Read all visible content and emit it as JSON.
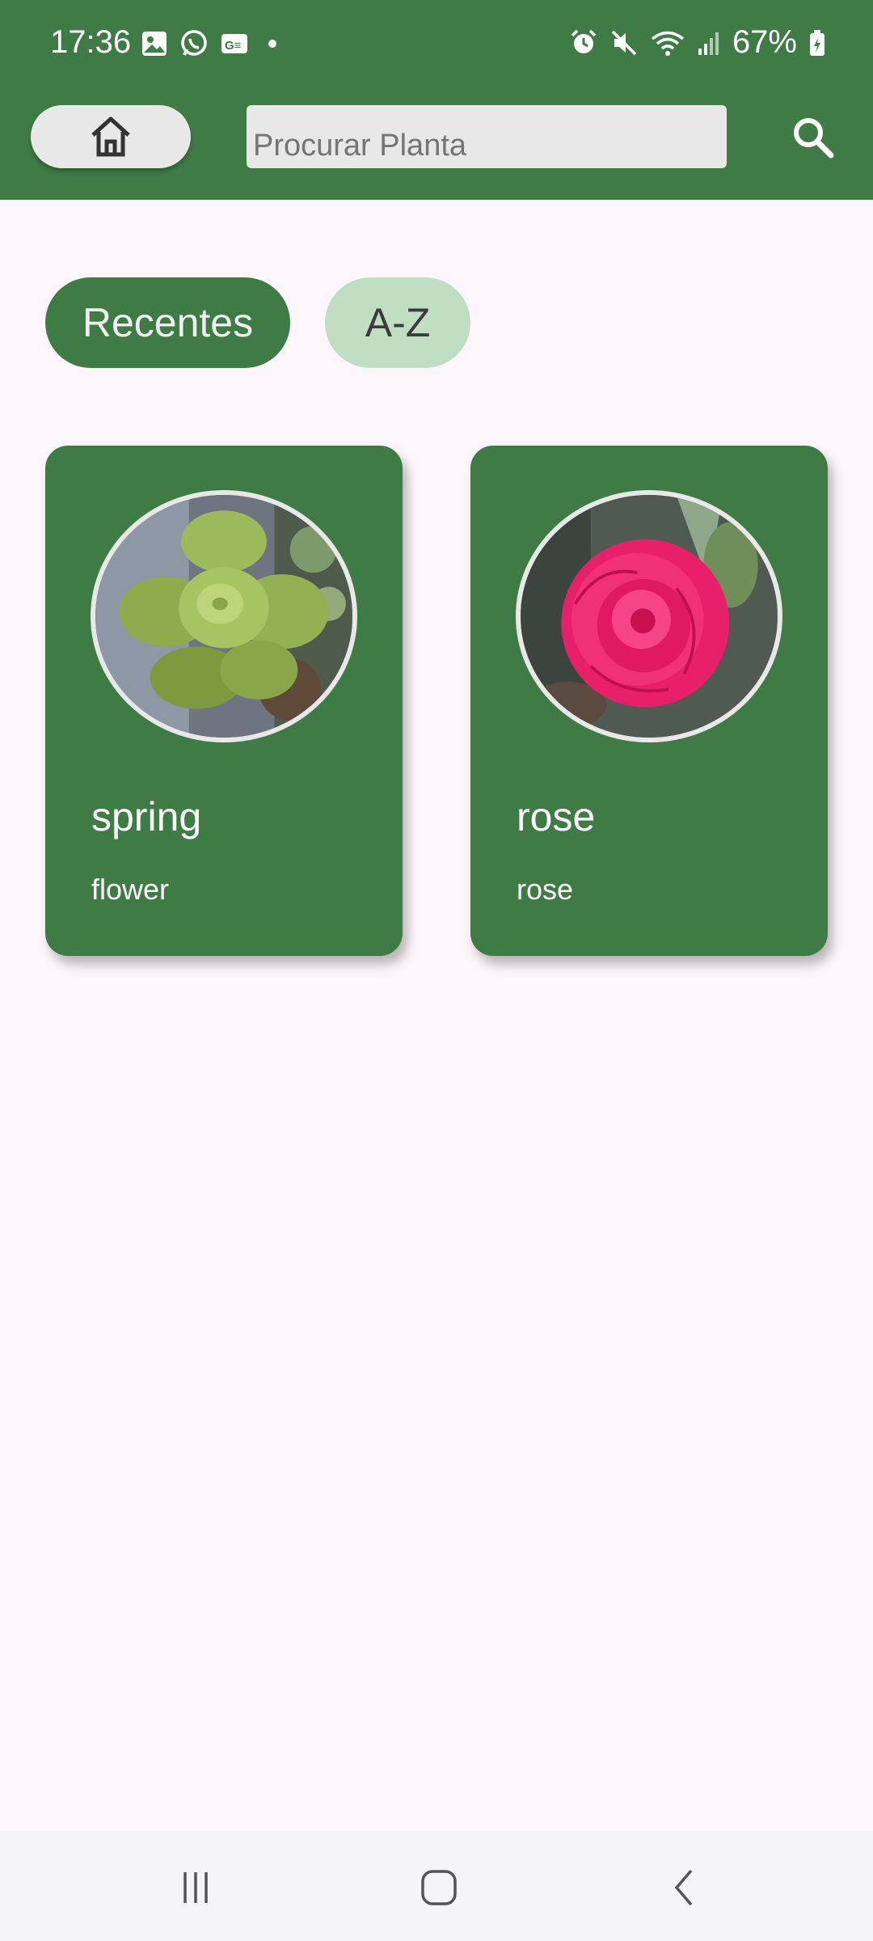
{
  "status_bar": {
    "time": "17:36",
    "battery": "67%",
    "left_icons": [
      "gallery-icon",
      "whatsapp-icon",
      "news-icon",
      "dot-icon"
    ],
    "right_icons": [
      "alarm-icon",
      "mute-icon",
      "wifi-icon",
      "signal-icon",
      "battery-icon"
    ]
  },
  "app_bar": {
    "color": "#3f7b45",
    "home_icon": "home-icon",
    "search_placeholder": "Procurar Planta",
    "search_icon": "search-icon"
  },
  "filters": {
    "recent_label": "Recentes",
    "az_label": "A-Z",
    "active": "Recentes"
  },
  "plants": [
    {
      "name": "spring",
      "type": "flower"
    },
    {
      "name": "rose",
      "type": "rose"
    }
  ],
  "nav_bar": {
    "icons": [
      "recent-apps-icon",
      "home-nav-icon",
      "back-icon"
    ]
  }
}
